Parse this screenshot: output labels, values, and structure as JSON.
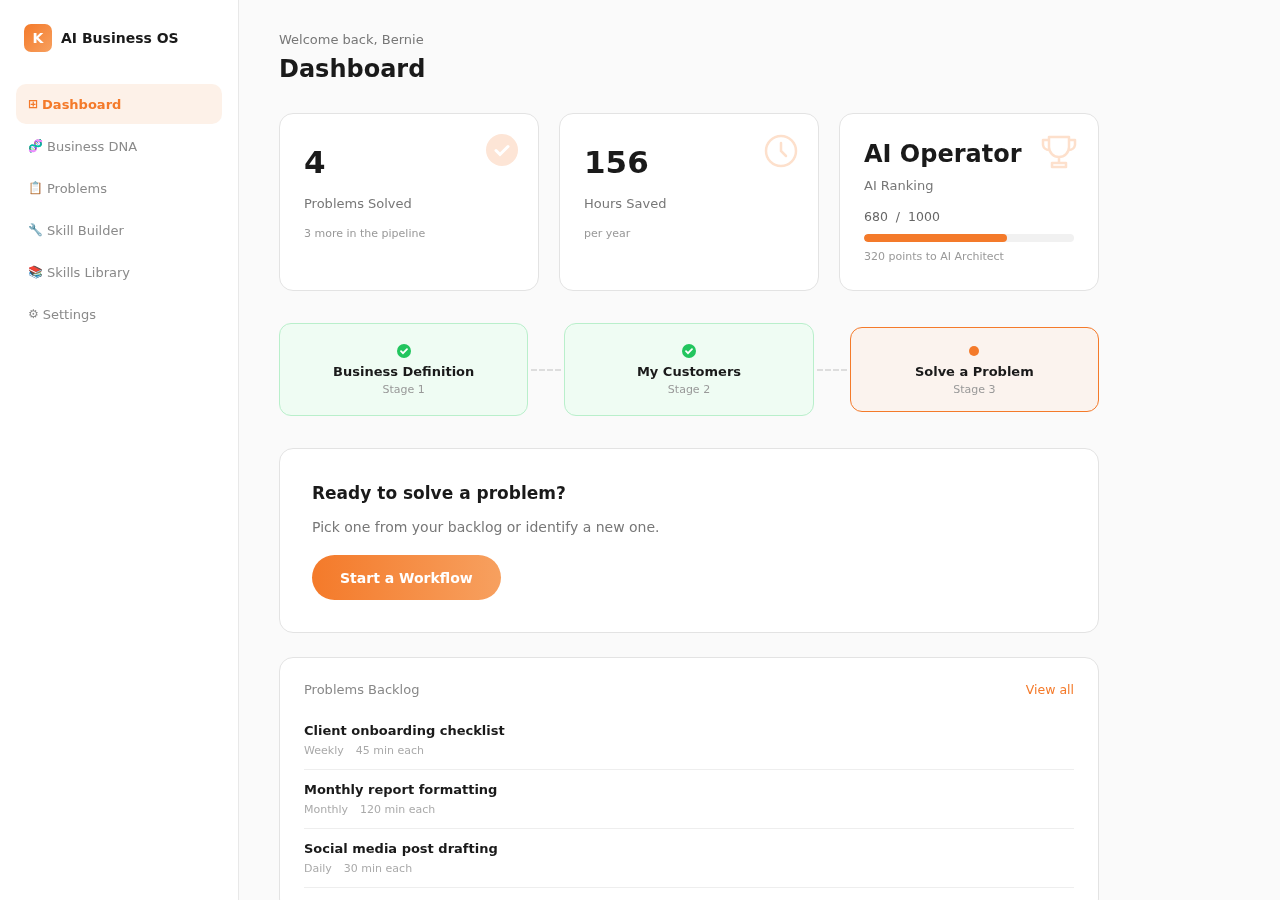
{
  "brand": {
    "logo_letter": "K",
    "name": "AI Business OS"
  },
  "sidebar": {
    "items": [
      {
        "icon": "⊞",
        "label": "Dashboard",
        "selected": true
      },
      {
        "icon": "🧬",
        "label": "Business DNA",
        "selected": false
      },
      {
        "icon": "📋",
        "label": "Problems",
        "selected": false
      },
      {
        "icon": "🔧",
        "label": "Skill Builder",
        "selected": false
      },
      {
        "icon": "📚",
        "label": "Skills Library",
        "selected": false
      },
      {
        "icon": "⚙",
        "label": "Settings",
        "selected": false
      }
    ]
  },
  "header": {
    "greeting": "Welcome back, Bernie",
    "title": "Dashboard"
  },
  "stats": [
    {
      "kind": "count",
      "value": "4",
      "label": "Problems Solved",
      "note": "3 more in the pipeline"
    },
    {
      "kind": "time",
      "value": "156",
      "label": "Hours Saved",
      "note": "per year"
    },
    {
      "kind": "rank",
      "value": "AI Operator",
      "label": "AI Ranking",
      "points": "680",
      "separator": "/",
      "max": "1000",
      "level": 0.68,
      "note": "320 points to AI Architect"
    }
  ],
  "stages": [
    {
      "title": "Business Definition",
      "subtitle": "Stage 1",
      "done": true
    },
    {
      "title": "My Customers",
      "subtitle": "Stage 2",
      "done": true
    },
    {
      "title": "Solve a Problem",
      "subtitle": "Stage 3",
      "done": false
    }
  ],
  "cta": {
    "title": "Ready to solve a problem?",
    "text": "Pick one from your backlog or identify a new one.",
    "button": "Start a Workflow"
  },
  "backlog": {
    "title": "Problems Backlog",
    "link": "View all",
    "rows": [
      {
        "title": "Client onboarding checklist",
        "frequency": "Weekly",
        "duration": "45 min each"
      },
      {
        "title": "Monthly report formatting",
        "frequency": "Monthly",
        "duration": "120 min each"
      },
      {
        "title": "Social media post drafting",
        "frequency": "Daily",
        "duration": "30 min each"
      }
    ]
  }
}
